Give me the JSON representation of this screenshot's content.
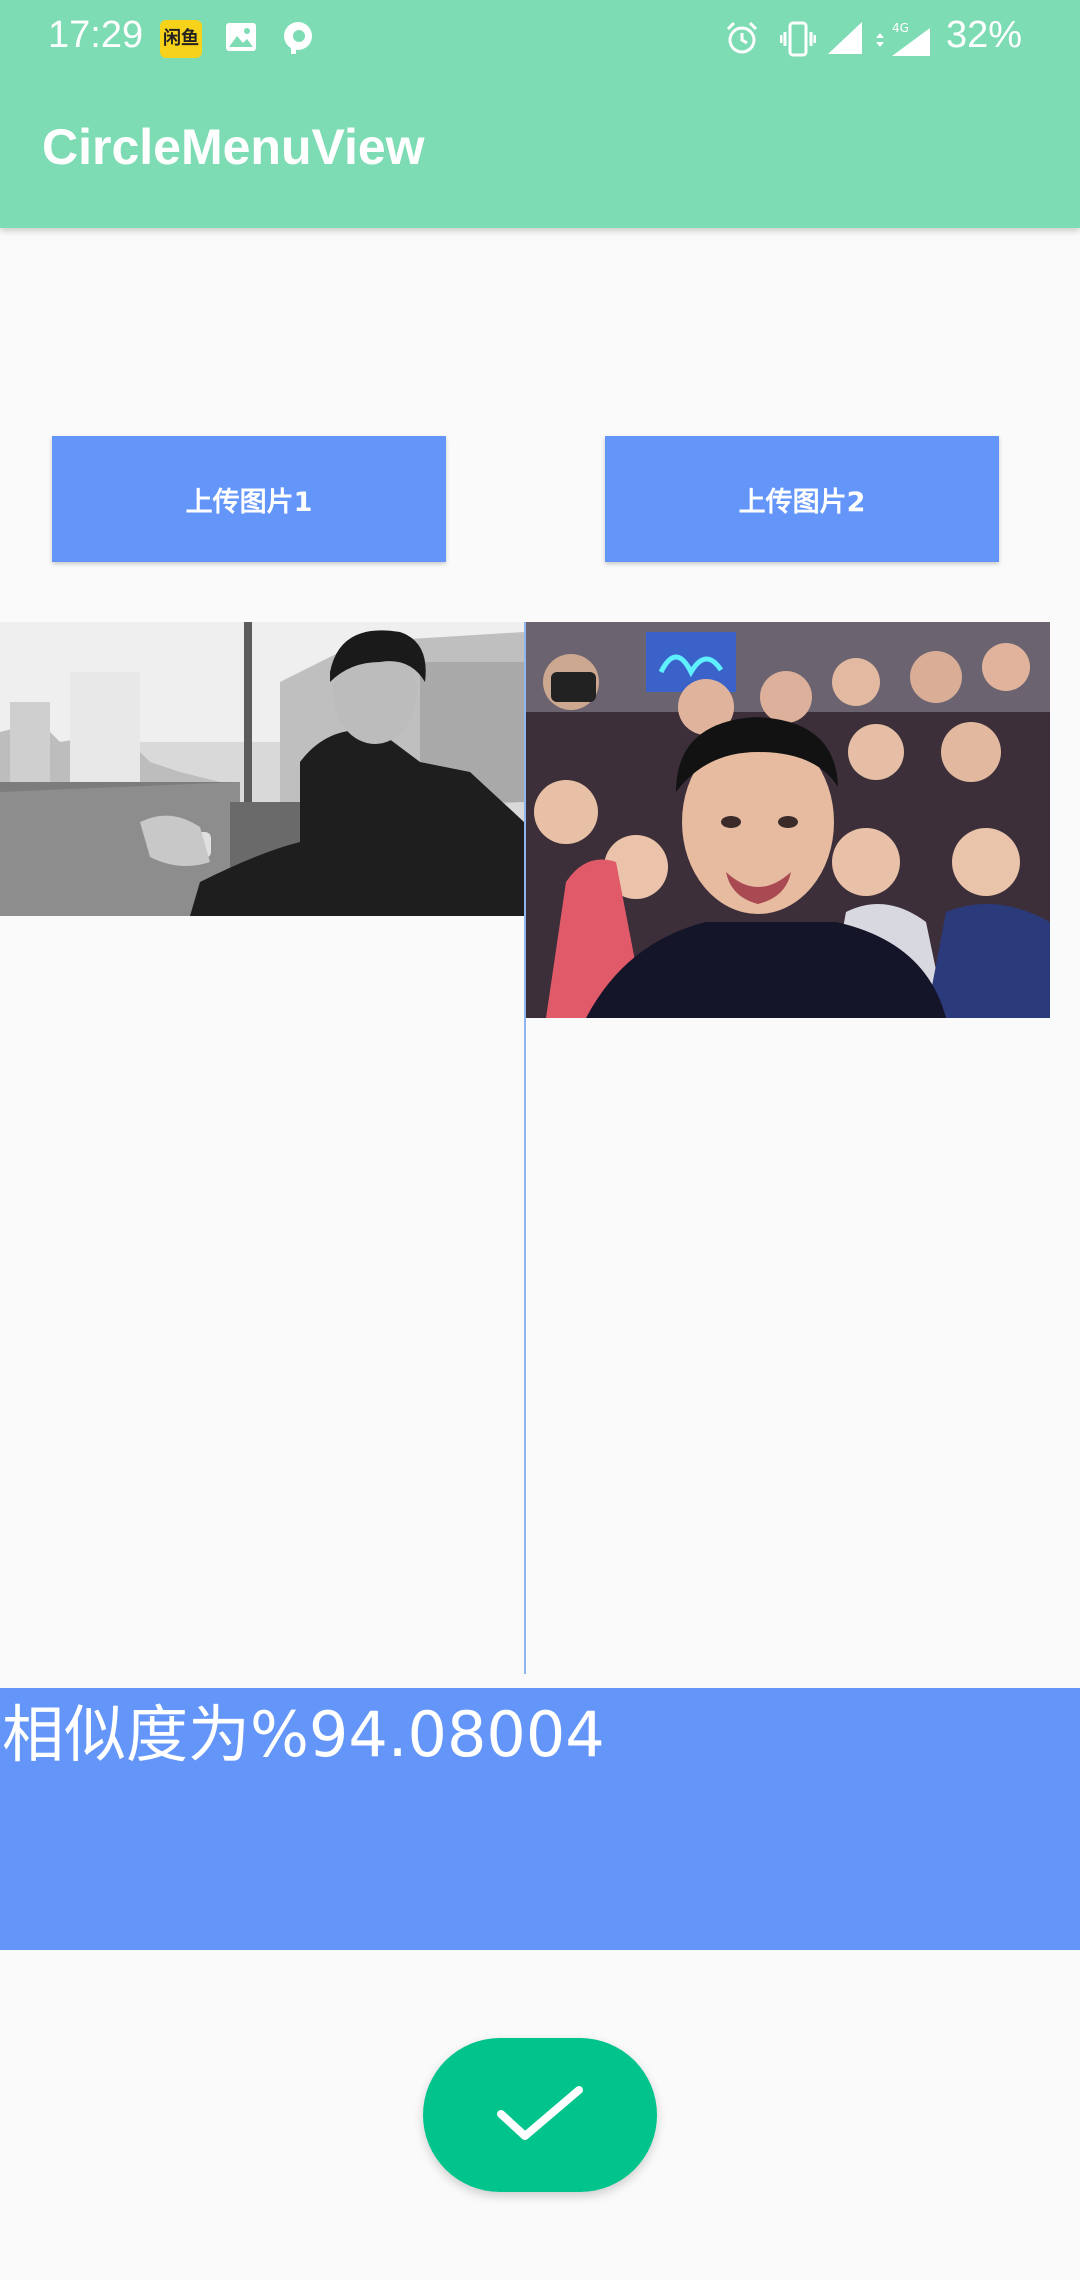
{
  "status_bar": {
    "time": "17:29",
    "battery": "32%",
    "app_icon_text": "闲鱼",
    "icons": [
      "xianyu-app-icon",
      "image-icon",
      "p-app-icon",
      "alarm-icon",
      "vibrate-icon",
      "signal-icon",
      "4g-signal-icon"
    ]
  },
  "app_bar": {
    "title": "CircleMenuView"
  },
  "buttons": {
    "upload1": "上传图片1",
    "upload2": "上传图片2"
  },
  "result": {
    "text": "相似度为%94.08004"
  },
  "fab": {
    "icon": "check-icon"
  },
  "colors": {
    "app_bar": "#7edcb4",
    "button": "#6496fa",
    "fab": "#00c48c",
    "background": "#fafafa"
  }
}
